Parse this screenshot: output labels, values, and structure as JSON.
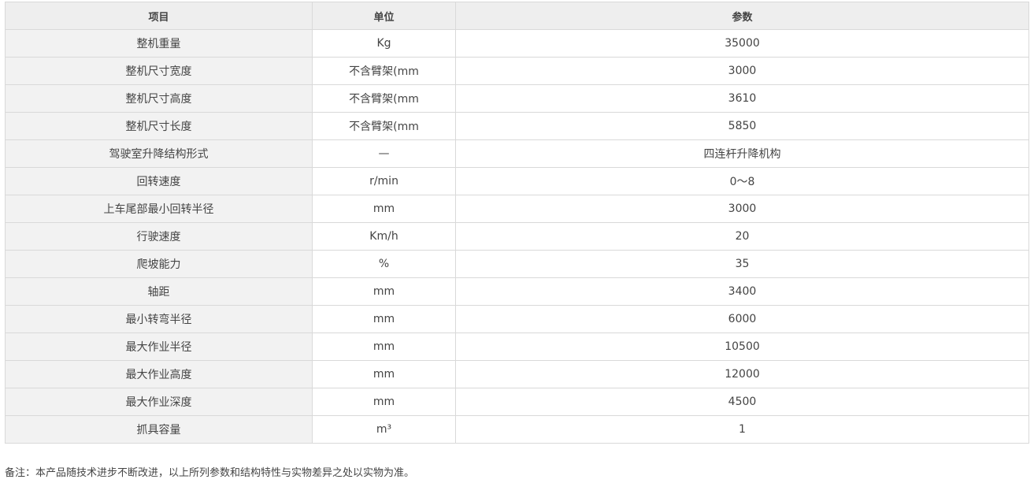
{
  "table": {
    "headers": [
      "项目",
      "单位",
      "参数"
    ],
    "rows": [
      {
        "item": "整机重量",
        "unit": "Kg",
        "value": "35000"
      },
      {
        "item": "整机尺寸宽度",
        "unit": "不含臂架(mm",
        "value": "3000"
      },
      {
        "item": "整机尺寸高度",
        "unit": "不含臂架(mm",
        "value": "3610"
      },
      {
        "item": "整机尺寸长度",
        "unit": "不含臂架(mm",
        "value": "5850"
      },
      {
        "item": "驾驶室升降结构形式",
        "unit": "—",
        "value": "四连杆升降机构"
      },
      {
        "item": "回转速度",
        "unit": "r/min",
        "value": "0～8"
      },
      {
        "item": "上车尾部最小回转半径",
        "unit": "mm",
        "value": "3000"
      },
      {
        "item": "行驶速度",
        "unit": "Km/h",
        "value": "20"
      },
      {
        "item": "爬坡能力",
        "unit": "%",
        "value": "35"
      },
      {
        "item": "轴距",
        "unit": "mm",
        "value": "3400"
      },
      {
        "item": "最小转弯半径",
        "unit": "mm",
        "value": "6000"
      },
      {
        "item": "最大作业半径",
        "unit": "mm",
        "value": "10500"
      },
      {
        "item": "最大作业高度",
        "unit": "mm",
        "value": "12000"
      },
      {
        "item": "最大作业深度",
        "unit": "mm",
        "value": "4500"
      },
      {
        "item": "抓具容量",
        "unit": "m³",
        "value": "1"
      }
    ]
  },
  "footnote": "备注：本产品随技术进步不断改进，以上所列参数和结构特性与实物差异之处以实物为准。"
}
